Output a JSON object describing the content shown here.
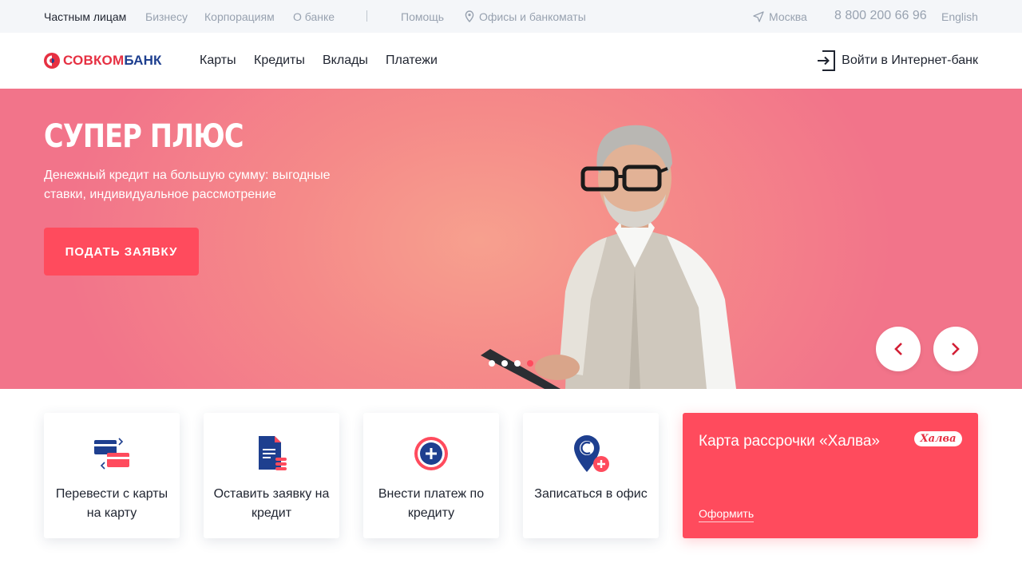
{
  "topbar": {
    "segments": [
      "Частным лицам",
      "Бизнесу",
      "Корпорациям",
      "О банке"
    ],
    "help": "Помощь",
    "offices": "Офисы и банкоматы",
    "city": "Москва",
    "phone": "8 800 200 66 96",
    "language": "English"
  },
  "header": {
    "logo_red": "СОВКОМ",
    "logo_blue": "БАНК",
    "nav": [
      "Карты",
      "Кредиты",
      "Вклады",
      "Платежи"
    ],
    "login": "Войти в Интернет-банк"
  },
  "hero": {
    "title": "СУПЕР ПЛЮС",
    "subtitle": "Денежный кредит на большую сумму: выгодные ставки, индивидуальное рассмотрение",
    "button": "ПОДАТЬ ЗАЯВКУ",
    "slides_total": 4,
    "active_slide": 4
  },
  "services": [
    {
      "label": "Перевести с карты на карту",
      "icon": "card-transfer-icon"
    },
    {
      "label": "Оставить заявку на кредит",
      "icon": "credit-application-icon"
    },
    {
      "label": "Внести платеж по кредиту",
      "icon": "payment-plus-icon"
    },
    {
      "label": "Записаться в офис",
      "icon": "office-location-icon"
    }
  ],
  "promo": {
    "title": "Карта рассрочки «Халва»",
    "badge": "Халва",
    "link": "Оформить"
  },
  "colors": {
    "accent": "#ff4b5d",
    "brand_blue": "#1e3f8f",
    "hero_bg": "#f58a89"
  }
}
